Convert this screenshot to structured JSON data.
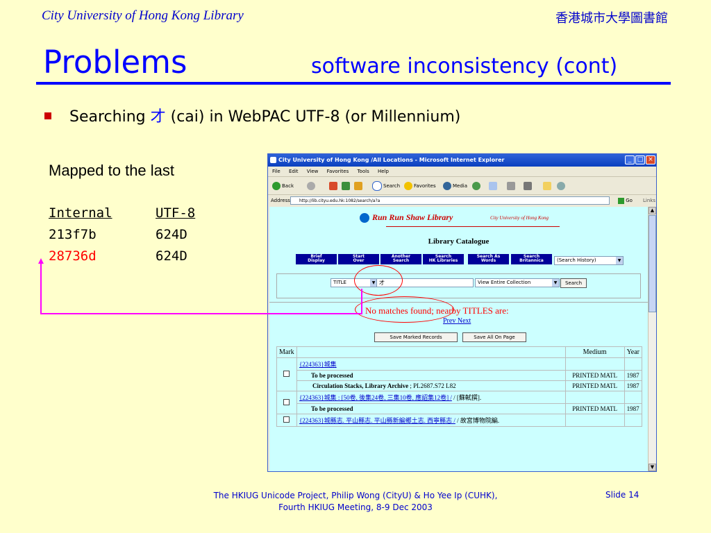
{
  "slide": {
    "header_left": "City University of Hong Kong Library",
    "header_right": "香港城市大學圖書館",
    "title": "Problems",
    "subtitle": "software inconsistency (cont)",
    "bullet_prefix": "Searching ",
    "bullet_char": "才",
    "bullet_suffix": " (cai) in WebPAC UTF-8 (or Millennium)",
    "mapped_label": "Mapped to the last",
    "mapping": {
      "headers": [
        "Internal",
        "UTF-8"
      ],
      "rows": [
        {
          "internal": "213f7b",
          "utf8": "624D",
          "highlight": false
        },
        {
          "internal": "28736d",
          "utf8": "624D",
          "highlight": true
        }
      ]
    },
    "footer_line1": "The HKIUG Unicode Project, Philip Wong (CityU) & Ho Yee Ip (CUHK),",
    "footer_line2": "Fourth HKIUG Meeting, 8-9 Dec 2003",
    "slide_number": "Slide 14",
    "colors": {
      "background": "#ffffcc",
      "title": "#0000ff",
      "bullet": "#cc0000",
      "highlight": "#ff0000",
      "arrow": "#ff00ff"
    }
  },
  "browser": {
    "window_title": "City University of Hong Kong /All Locations - Microsoft Internet Explorer",
    "menu": [
      "File",
      "Edit",
      "View",
      "Favorites",
      "Tools",
      "Help"
    ],
    "toolbar": {
      "back": "Back",
      "search": "Search",
      "favorites": "Favorites",
      "media": "Media"
    },
    "address_label": "Address",
    "address": "http://lib.cityu.edu.hk:1082/search/a?a",
    "go": "Go",
    "links": "Links",
    "page": {
      "logo": "Run Run Shaw Library",
      "logo_sub": "City University of Hong Kong",
      "catalogue_title": "Library Catalogue",
      "nav_buttons": [
        {
          "l1": "Brief",
          "l2": "Display"
        },
        {
          "l1": "Start",
          "l2": "Over"
        },
        {
          "l1": "Another",
          "l2": "Search"
        },
        {
          "l1": "Search",
          "l2": "HK Libraries"
        },
        {
          "l1": "Search As",
          "l2": "Words"
        },
        {
          "l1": "Search",
          "l2": "Britannica"
        }
      ],
      "history_select": "(Search History)",
      "search_type": "TITLE",
      "search_value": "才",
      "scope": "View Entire Collection",
      "search_button": "Search",
      "no_match": "No matches found; nearby TITLES are:",
      "prev": "Prev",
      "next": "Next",
      "save_marked": "Save Marked Records",
      "save_all": "Save All On Page",
      "table_headers": {
        "mark": "Mark",
        "medium": "Medium",
        "year": "Year"
      },
      "results": {
        "r1_title": "{224363}城集",
        "r1_status": "To be processed",
        "r1_medium": "PRINTED MATL",
        "r1_year": "1987",
        "r1_loc": "Circulation Stacks, Library Archive",
        "r1_call": " ; PL2687.S72 L82",
        "r1b_medium": "PRINTED MATL",
        "r1b_year": "1987",
        "r2_title": "{224363}城集 : [50卷, 後集24卷, 三集10卷, 應詔集12卷] /",
        "r2_resp": " / [蘇軾撰].",
        "r2_status": "To be processed",
        "r2_medium": "PRINTED MATL",
        "r2_year": "1987",
        "r3_title": "{224363}城縣志. 平山縣志. 平山縣新編鄉土志. 西寧縣志 /",
        "r3_resp": " / 故宮博物院編."
      }
    }
  }
}
